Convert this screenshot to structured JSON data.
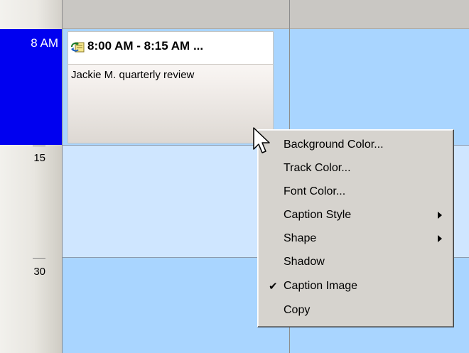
{
  "time_ruler": {
    "hour_label": "8 AM",
    "minute_labels": [
      "15",
      "30"
    ]
  },
  "appointment": {
    "time_range": "8:00 AM - 8:15 AM ...",
    "subject": "Jackie M. quarterly review",
    "icon": "recurrence-icon"
  },
  "context_menu": {
    "items": [
      {
        "label": "Background Color...",
        "checked": false,
        "submenu": false
      },
      {
        "label": "Track Color...",
        "checked": false,
        "submenu": false
      },
      {
        "label": "Font Color...",
        "checked": false,
        "submenu": false
      },
      {
        "label": "Caption Style",
        "checked": false,
        "submenu": true
      },
      {
        "label": "Shape",
        "checked": false,
        "submenu": true
      },
      {
        "label": "Shadow",
        "checked": false,
        "submenu": false
      },
      {
        "label": "Caption Image",
        "checked": true,
        "submenu": false
      },
      {
        "label": "Copy",
        "checked": false,
        "submenu": false
      }
    ]
  },
  "colors": {
    "hour_highlight": "#0000f0",
    "slot_primary": "#a9d5ff",
    "slot_secondary": "#cfe6ff",
    "menu_background": "#d6d3ce"
  }
}
